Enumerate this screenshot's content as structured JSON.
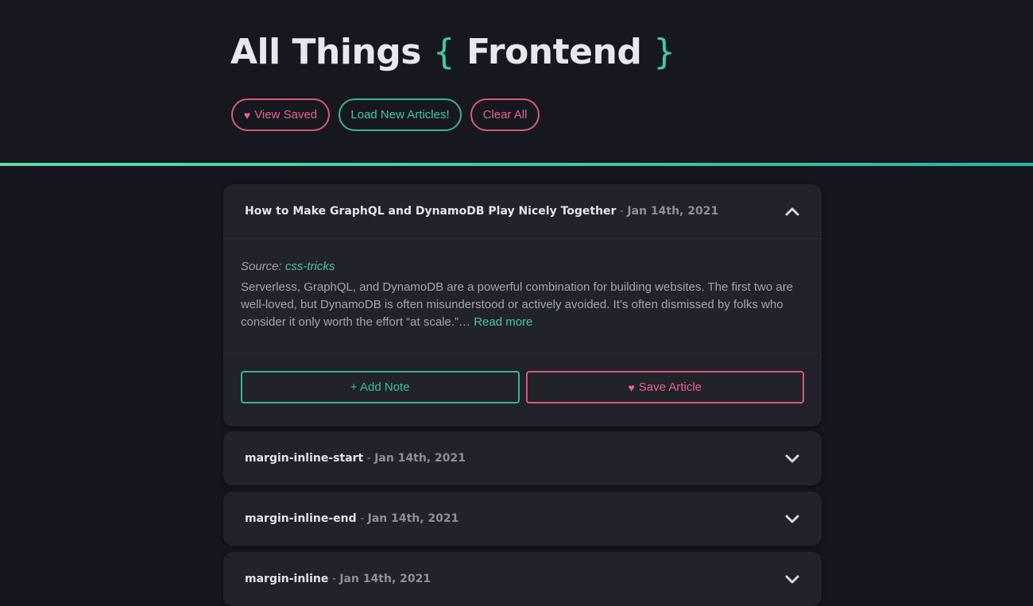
{
  "header": {
    "title_main": "All Things",
    "brace_open": "{",
    "title_accent": "Frontend",
    "brace_close": "}",
    "buttons": {
      "view_saved": "View Saved",
      "load_new": "Load New Articles!",
      "clear_all": "Clear All"
    }
  },
  "articles": [
    {
      "title": "How to Make GraphQL and DynamoDB Play Nicely Together",
      "separator": " - ",
      "date": "Jan 14th, 2021",
      "expanded": true,
      "source_label": "Source:",
      "source_name": "css-tricks",
      "description": "Serverless, GraphQL, and DynamoDB are a powerful combination for building websites. The first two are well-loved, but DynamoDB is often misunderstood or actively avoided. It’s often dismissed by folks who consider it only worth the effort “at scale.”…",
      "read_more": "Read more",
      "add_note": "+ Add Note",
      "save_article": "Save Article"
    },
    {
      "title": "margin-inline-start",
      "separator": " - ",
      "date": "Jan 14th, 2021",
      "expanded": false
    },
    {
      "title": "margin-inline-end",
      "separator": " - ",
      "date": "Jan 14th, 2021",
      "expanded": false
    },
    {
      "title": "margin-inline",
      "separator": " - ",
      "date": "Jan 14th, 2021",
      "expanded": false
    }
  ],
  "icons": {
    "heart": "heart-icon",
    "chevron_up": "chevron-up-icon",
    "chevron_down": "chevron-down-icon"
  },
  "colors": {
    "background": "#15161d",
    "accent_teal": "#42c9a3",
    "accent_pink": "#d9577f",
    "card": "#21222a"
  }
}
